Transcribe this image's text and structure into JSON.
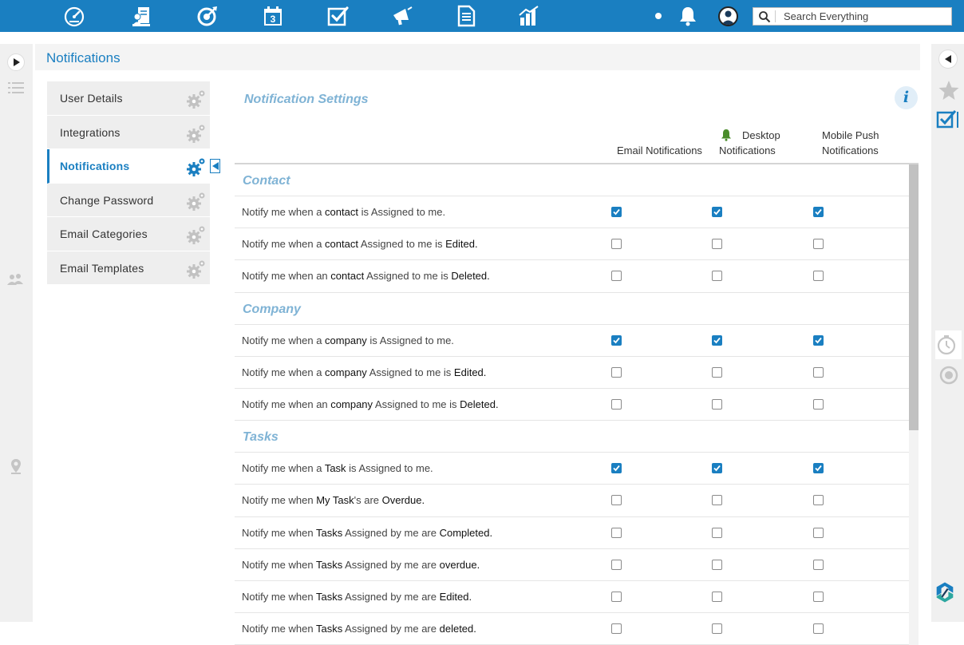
{
  "page": {
    "title": "Notifications"
  },
  "search": {
    "placeholder": "Search Everything"
  },
  "topnav": {
    "icons": [
      "dashboard-icon",
      "contacts-icon",
      "leads-target-icon",
      "calendar-icon",
      "tasks-icon",
      "campaign-megaphone-icon",
      "documents-icon",
      "reports-chart-icon"
    ],
    "calendar_day": "3"
  },
  "settings_menu": [
    {
      "label": "User Details",
      "active": false
    },
    {
      "label": "Integrations",
      "active": false
    },
    {
      "label": "Notifications",
      "active": true
    },
    {
      "label": "Change Password",
      "active": false
    },
    {
      "label": "Email Categories",
      "active": false
    },
    {
      "label": "Email Templates",
      "active": false
    }
  ],
  "notification_settings": {
    "heading": "Notification Settings",
    "info_glyph": "i",
    "columns": {
      "email": "Email Notifications",
      "desktop_line1": "Desktop",
      "desktop_line2": "Notifications",
      "mobile_line1": "Mobile Push",
      "mobile_line2": "Notifications"
    },
    "groups": [
      {
        "title": "Contact",
        "rows": [
          {
            "label": "Notify me when a <b>contact</b> is Assigned to me.",
            "email": true,
            "desktop": true,
            "mobile": true
          },
          {
            "label": "Notify me when a <b>contact</b> Assigned to me is <b>Edited.</b>",
            "email": false,
            "desktop": false,
            "mobile": false
          },
          {
            "label": "Notify me when an <b>contact</b> Assigned to me is <b>Deleted.</b>",
            "email": false,
            "desktop": false,
            "mobile": false
          }
        ]
      },
      {
        "title": "Company",
        "rows": [
          {
            "label": "Notify me when a <b>company</b> is Assigned to me.",
            "email": true,
            "desktop": true,
            "mobile": true
          },
          {
            "label": "Notify me when a <b>company</b> Assigned to me is <b>Edited.</b>",
            "email": false,
            "desktop": false,
            "mobile": false
          },
          {
            "label": "Notify me when an <b>company</b> Assigned to me is <b>Deleted.</b>",
            "email": false,
            "desktop": false,
            "mobile": false
          }
        ]
      },
      {
        "title": "Tasks",
        "rows": [
          {
            "label": "Notify me when a <b>Task</b> is Assigned to me.",
            "email": true,
            "desktop": true,
            "mobile": true
          },
          {
            "label": "Notify me when <b>My Task</b>'s are <b>Overdue.</b>",
            "email": false,
            "desktop": false,
            "mobile": false
          },
          {
            "label": "Notify me when <b>Tasks</b> Assigned by me are <b>Completed.</b>",
            "email": false,
            "desktop": false,
            "mobile": false
          },
          {
            "label": "Notify me when <b>Tasks</b> Assigned by me are <b>overdue.</b>",
            "email": false,
            "desktop": false,
            "mobile": false
          },
          {
            "label": "Notify me when <b>Tasks</b> Assigned by me are <b>Edited.</b>",
            "email": false,
            "desktop": false,
            "mobile": false
          },
          {
            "label": "Notify me when <b>Tasks</b> Assigned by me are <b>deleted.</b>",
            "email": false,
            "desktop": false,
            "mobile": false
          }
        ]
      }
    ]
  },
  "colors": {
    "brand": "#1a7fc1",
    "group_title": "#7fb3d5",
    "desktop_bell": "#4a8c2a"
  }
}
